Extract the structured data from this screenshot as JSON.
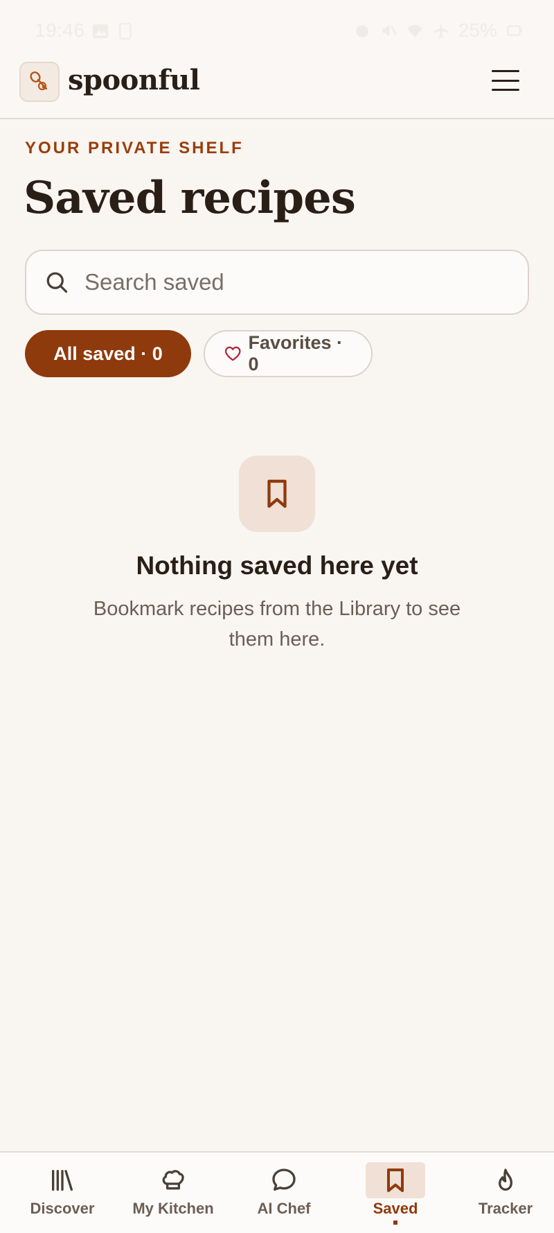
{
  "status_bar": {
    "time": "19:46",
    "battery": "25%"
  },
  "header": {
    "brand": "spoonful"
  },
  "page": {
    "eyebrow": "YOUR PRIVATE SHELF",
    "title": "Saved recipes"
  },
  "search": {
    "placeholder": "Search saved",
    "value": ""
  },
  "filters": [
    {
      "label": "All saved · 0",
      "active": true
    },
    {
      "label": "Favorites · 0",
      "active": false
    }
  ],
  "empty_state": {
    "title": "Nothing saved here yet",
    "subtitle": "Bookmark recipes from the Library to see them here."
  },
  "bottom_nav": {
    "items": [
      {
        "label": "Discover",
        "icon": "library-icon",
        "active": false
      },
      {
        "label": "My Kitchen",
        "icon": "chef-hat-icon",
        "active": false
      },
      {
        "label": "AI Chef",
        "icon": "chat-bubble-icon",
        "active": false
      },
      {
        "label": "Saved",
        "icon": "bookmark-icon",
        "active": true
      },
      {
        "label": "Tracker",
        "icon": "flame-icon",
        "active": false
      }
    ]
  },
  "colors": {
    "accent": "#8f3a0c",
    "background": "#f9f5f1",
    "text": "#2a1f17"
  }
}
